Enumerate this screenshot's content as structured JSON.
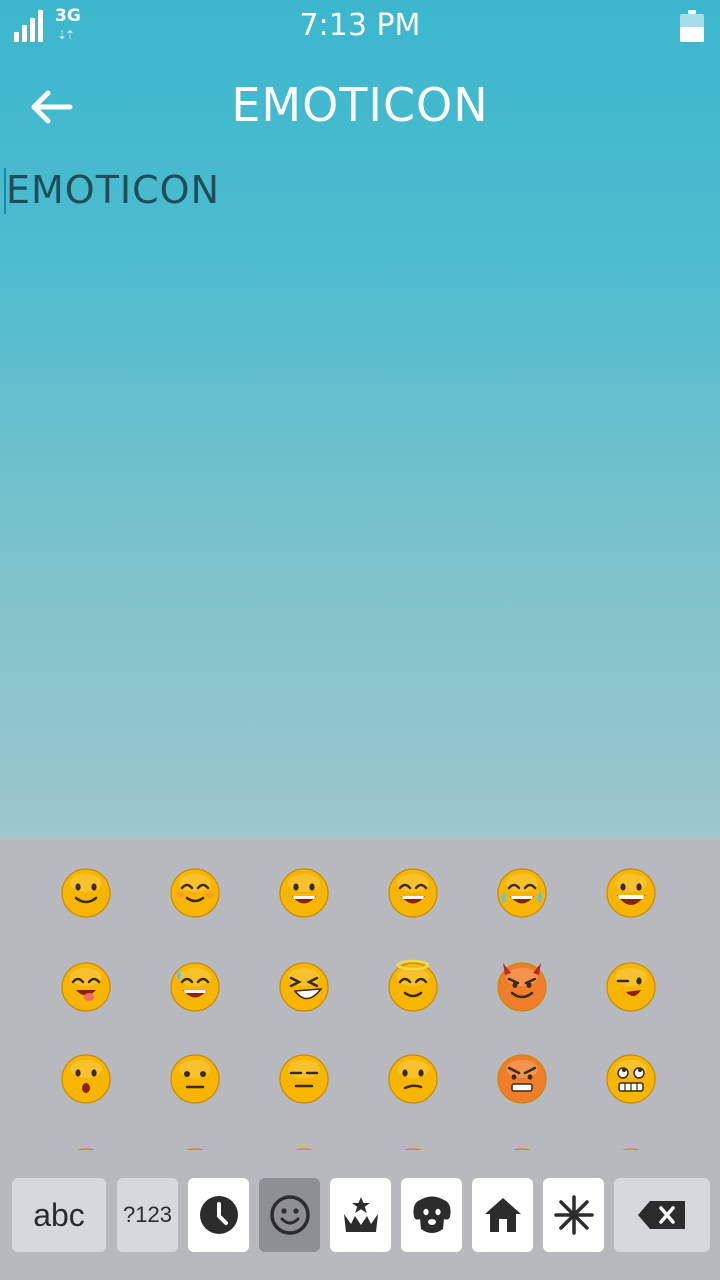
{
  "status": {
    "network": "3G",
    "time": "7:13 PM",
    "battery_level": 0.55
  },
  "appbar": {
    "title": "EMOTICON",
    "back_icon": "arrow-left-icon"
  },
  "editor": {
    "text": "EMOTICON"
  },
  "emoji_rows": [
    [
      "smile",
      "blush",
      "grin",
      "laugh",
      "joy-tears",
      "big-grin"
    ],
    [
      "tongue",
      "sweat-grin",
      "laughing-squint",
      "angel",
      "devil",
      "wink"
    ],
    [
      "surprised",
      "neutral",
      "expressionless",
      "confused",
      "angry",
      "grimace-roll"
    ]
  ],
  "keyboard": {
    "abc_label": "abc",
    "symbols_label": "?123",
    "categories": [
      {
        "icon": "clock-icon",
        "active": false
      },
      {
        "icon": "smiley-icon",
        "active": true
      },
      {
        "icon": "crown-icon",
        "active": false
      },
      {
        "icon": "dog-icon",
        "active": false
      },
      {
        "icon": "house-icon",
        "active": false
      },
      {
        "icon": "asterisk-icon",
        "active": false
      }
    ],
    "delete_icon": "backspace-icon"
  },
  "colors": {
    "accent": "#3cb7ce",
    "keyboard_bg": "#b8b9be",
    "emoji_yellow": "#f7b500"
  }
}
